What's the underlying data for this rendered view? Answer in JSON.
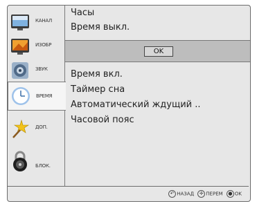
{
  "sidebar": {
    "items": [
      {
        "label": "КАНАЛ",
        "icon": "channel-icon"
      },
      {
        "label": "ИЗОБР",
        "icon": "picture-icon"
      },
      {
        "label": "ЗВУК",
        "icon": "sound-icon"
      },
      {
        "label": "ВРЕМЯ",
        "icon": "clock-icon",
        "active": true
      },
      {
        "label": "ДОП.",
        "icon": "star-wand-icon"
      },
      {
        "label": "БЛОК.",
        "icon": "lock-icon"
      }
    ]
  },
  "main": {
    "top_items": [
      "Часы",
      "Время выкл."
    ],
    "ok_label": "OK",
    "lower_items": [
      "Время вкл.",
      "Таймер сна",
      "Автоматический ждущий ..",
      "Часовой пояс"
    ]
  },
  "footer": {
    "back_label": "НАЗАД",
    "move_label": "ПЕРЕМ",
    "ok_label": "OK"
  }
}
